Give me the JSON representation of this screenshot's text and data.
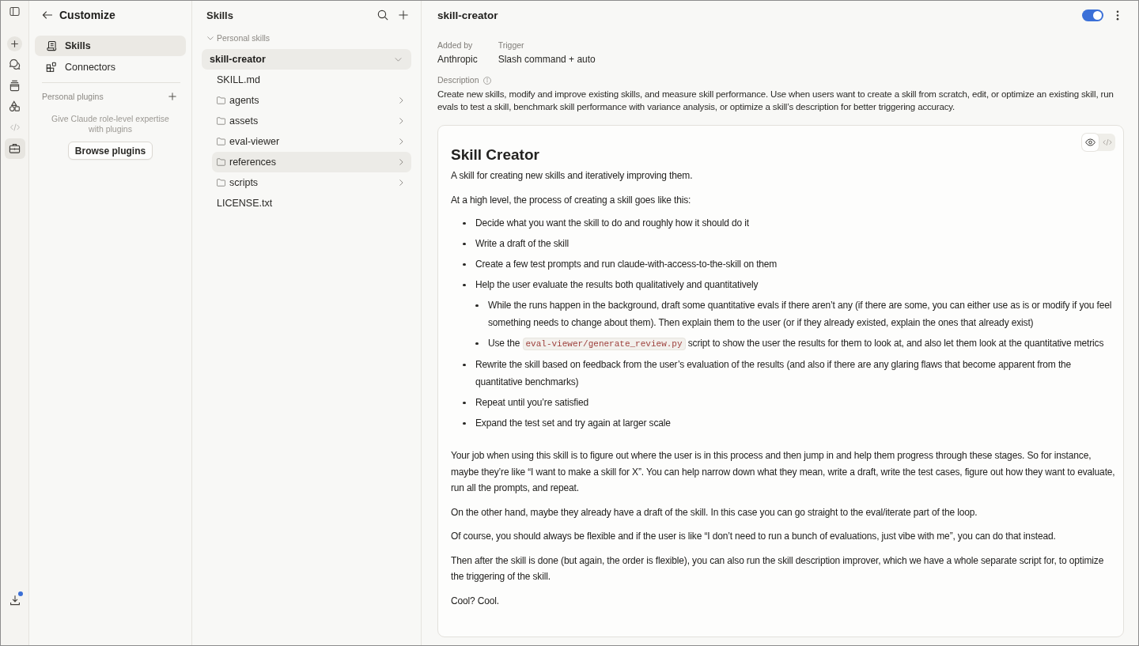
{
  "rail": {
    "items": [
      {
        "kind": "new",
        "selected": false,
        "disabled": false
      },
      {
        "kind": "chats",
        "selected": false,
        "disabled": false
      },
      {
        "kind": "projects",
        "selected": false,
        "disabled": false
      },
      {
        "kind": "artifacts",
        "selected": false,
        "disabled": false
      },
      {
        "kind": "code",
        "selected": false,
        "disabled": true
      },
      {
        "kind": "customize",
        "selected": true,
        "disabled": false
      }
    ],
    "footer": {
      "kind": "download",
      "notification": true
    }
  },
  "customize": {
    "title": "Customize",
    "nav": [
      {
        "kind": "skills",
        "label": "Skills",
        "selected": true
      },
      {
        "kind": "connectors",
        "label": "Connectors",
        "selected": false
      }
    ],
    "plugins": {
      "heading": "Personal plugins",
      "empty_text": "Give Claude role-level expertise with plugins",
      "button": "Browse plugins"
    }
  },
  "skills_panel": {
    "title": "Skills",
    "groups": [
      {
        "label": "Personal skills",
        "expanded": true,
        "skills": [
          {
            "name": "skill-creator",
            "selected": true,
            "expanded": true,
            "children": [
              {
                "kind": "file",
                "name": "SKILL.md",
                "selected": false
              },
              {
                "kind": "folder",
                "name": "agents",
                "selected": false,
                "expanded": false
              },
              {
                "kind": "folder",
                "name": "assets",
                "selected": false,
                "expanded": false
              },
              {
                "kind": "folder",
                "name": "eval-viewer",
                "selected": false,
                "expanded": false
              },
              {
                "kind": "folder",
                "name": "references",
                "selected": true,
                "expanded": false
              },
              {
                "kind": "folder",
                "name": "scripts",
                "selected": false,
                "expanded": false
              },
              {
                "kind": "file",
                "name": "LICENSE.txt",
                "selected": false
              }
            ]
          }
        ]
      }
    ]
  },
  "detail": {
    "title": "skill-creator",
    "enabled": true,
    "meta": [
      {
        "label": "Added by",
        "value": "Anthropic"
      },
      {
        "label": "Trigger",
        "value": "Slash command + auto"
      }
    ],
    "description_label": "Description",
    "description": "Create new skills, modify and improve existing skills, and measure skill performance. Use when users want to create a skill from scratch, edit, or optimize an existing skill, run evals to test a skill, benchmark skill performance with variance analysis, or optimize a skill’s description for better triggering accuracy.",
    "view_modes": [
      {
        "kind": "preview",
        "selected": true
      },
      {
        "kind": "source",
        "selected": false
      }
    ],
    "document": {
      "blocks": [
        {
          "kind": "heading",
          "text": "Skill Creator"
        },
        {
          "kind": "paragraph",
          "text": "A skill for creating new skills and iteratively improving them."
        },
        {
          "kind": "paragraph",
          "text": "At a high level, the process of creating a skill goes like this:"
        },
        {
          "kind": "list",
          "items": [
            {
              "text": "Decide what you want the skill to do and roughly how it should do it"
            },
            {
              "text": "Write a draft of the skill"
            },
            {
              "text": "Create a few test prompts and run claude-with-access-to-the-skill on them"
            },
            {
              "text": "Help the user evaluate the results both qualitatively and quantitatively",
              "children": [
                {
                  "text": "While the runs happen in the background, draft some quantitative evals if there aren’t any (if there are some, you can either use as is or modify if you feel something needs to change about them). Then explain them to the user (or if they already existed, explain the ones that already exist)"
                },
                {
                  "segments": [
                    {
                      "kind": "text",
                      "text": "Use the "
                    },
                    {
                      "kind": "code",
                      "text": "eval-viewer/generate_review.py"
                    },
                    {
                      "kind": "text",
                      "text": " script to show the user the results for them to look at, and also let them look at the quantitative metrics"
                    }
                  ]
                }
              ]
            },
            {
              "text": "Rewrite the skill based on feedback from the user’s evaluation of the results (and also if there are any glaring flaws that become apparent from the quantitative benchmarks)"
            },
            {
              "text": "Repeat until you’re satisfied"
            },
            {
              "text": "Expand the test set and try again at larger scale"
            }
          ]
        },
        {
          "kind": "paragraph",
          "text": "Your job when using this skill is to figure out where the user is in this process and then jump in and help them progress through these stages. So for instance, maybe they’re like “I want to make a skill for X”. You can help narrow down what they mean, write a draft, write the test cases, figure out how they want to evaluate, run all the prompts, and repeat."
        },
        {
          "kind": "paragraph",
          "text": "On the other hand, maybe they already have a draft of the skill. In this case you can go straight to the eval/iterate part of the loop."
        },
        {
          "kind": "paragraph",
          "text": "Of course, you should always be flexible and if the user is like “I don’t need to run a bunch of evaluations, just vibe with me”, you can do that instead."
        },
        {
          "kind": "paragraph",
          "text": "Then after the skill is done (but again, the order is flexible), you can also run the skill description improver, which we have a whole separate script for, to optimize the triggering of the skill."
        },
        {
          "kind": "paragraph",
          "text": "Cool? Cool."
        }
      ]
    }
  }
}
